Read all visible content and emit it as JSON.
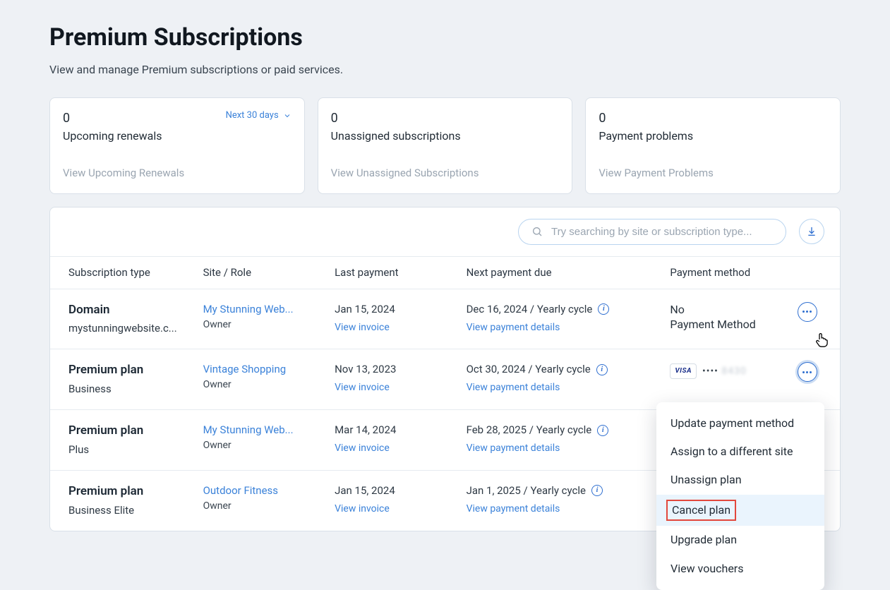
{
  "header": {
    "title": "Premium Subscriptions",
    "subtitle": "View and manage Premium subscriptions or paid services."
  },
  "cards": [
    {
      "count": "0",
      "label": "Upcoming renewals",
      "period": "Next 30 days",
      "footer": "View Upcoming Renewals"
    },
    {
      "count": "0",
      "label": "Unassigned subscriptions",
      "period": "",
      "footer": "View Unassigned Subscriptions"
    },
    {
      "count": "0",
      "label": "Payment problems",
      "period": "",
      "footer": "View Payment Problems"
    }
  ],
  "search": {
    "placeholder": "Try searching by site or subscription type..."
  },
  "columns": {
    "sub": "Subscription type",
    "site": "Site / Role",
    "last": "Last payment",
    "next": "Next payment due",
    "pay": "Payment method"
  },
  "labels": {
    "view_invoice": "View invoice",
    "view_payment_details": "View payment details"
  },
  "rows": [
    {
      "name": "Domain",
      "sub": "mystunningwebsite.c...",
      "site": "My Stunning Web...",
      "role": "Owner",
      "last": "Jan 15, 2024",
      "next": "Dec 16, 2024 / Yearly cycle",
      "pay_type": "none",
      "pay_text": "No Payment Method"
    },
    {
      "name": "Premium plan",
      "sub": "Business",
      "site": "Vintage Shopping",
      "role": "Owner",
      "last": "Nov 13, 2023",
      "next": "Oct 30, 2024 / Yearly cycle",
      "pay_type": "visa",
      "pay_brand": "VISA",
      "pay_mask": "••••",
      "pay_last4": "8430"
    },
    {
      "name": "Premium plan",
      "sub": "Plus",
      "site": "My Stunning Web...",
      "role": "Owner",
      "last": "Mar 14, 2024",
      "next": "Feb 28, 2025 / Yearly cycle",
      "pay_type": "hidden"
    },
    {
      "name": "Premium plan",
      "sub": "Business Elite",
      "site": "Outdoor Fitness",
      "role": "Owner",
      "last": "Jan 15, 2024",
      "next": "Jan 1, 2025 / Yearly cycle",
      "pay_type": "hidden"
    }
  ],
  "dropdown": {
    "items": [
      "Update payment method",
      "Assign to a different site",
      "Unassign plan",
      "Cancel plan",
      "Upgrade plan",
      "View vouchers"
    ],
    "highlight_index": 3
  }
}
